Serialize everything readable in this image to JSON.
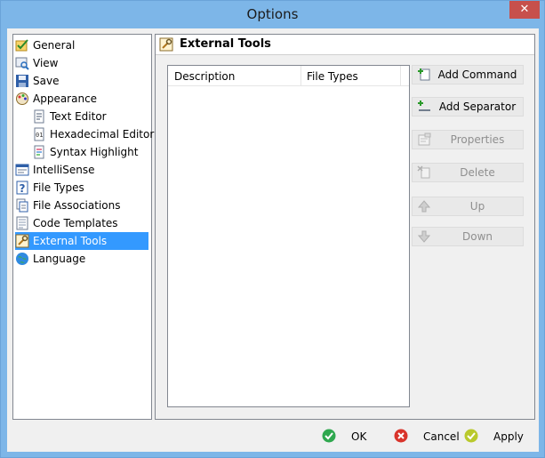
{
  "window": {
    "title": "Options",
    "close_glyph": "✕"
  },
  "tree": {
    "items": [
      {
        "label": "General",
        "icon": "general-icon"
      },
      {
        "label": "View",
        "icon": "view-icon"
      },
      {
        "label": "Save",
        "icon": "save-icon"
      },
      {
        "label": "Appearance",
        "icon": "appearance-icon"
      },
      {
        "label": "Text Editor",
        "icon": "text-editor-icon"
      },
      {
        "label": "Hexadecimal Editor",
        "icon": "hex-editor-icon"
      },
      {
        "label": "Syntax Highlight",
        "icon": "syntax-highlight-icon"
      },
      {
        "label": "IntelliSense",
        "icon": "intellisense-icon"
      },
      {
        "label": "File Types",
        "icon": "file-types-icon"
      },
      {
        "label": "File Associations",
        "icon": "file-associations-icon"
      },
      {
        "label": "Code Templates",
        "icon": "code-templates-icon"
      },
      {
        "label": "External Tools",
        "icon": "external-tools-icon",
        "selected": true
      },
      {
        "label": "Language",
        "icon": "language-icon"
      }
    ]
  },
  "panel": {
    "title": "External Tools",
    "list": {
      "col_description": "Description",
      "col_file_types": "File Types"
    },
    "buttons": {
      "add_command": "Add Command",
      "add_separator": "Add Separator",
      "properties": "Properties",
      "delete": "Delete",
      "up": "Up",
      "down": "Down"
    }
  },
  "footer": {
    "ok": "OK",
    "cancel": "Cancel",
    "apply": "Apply"
  },
  "colors": {
    "title_bar": "#7db6e8",
    "selection": "#3399ff",
    "close": "#c7504c"
  }
}
